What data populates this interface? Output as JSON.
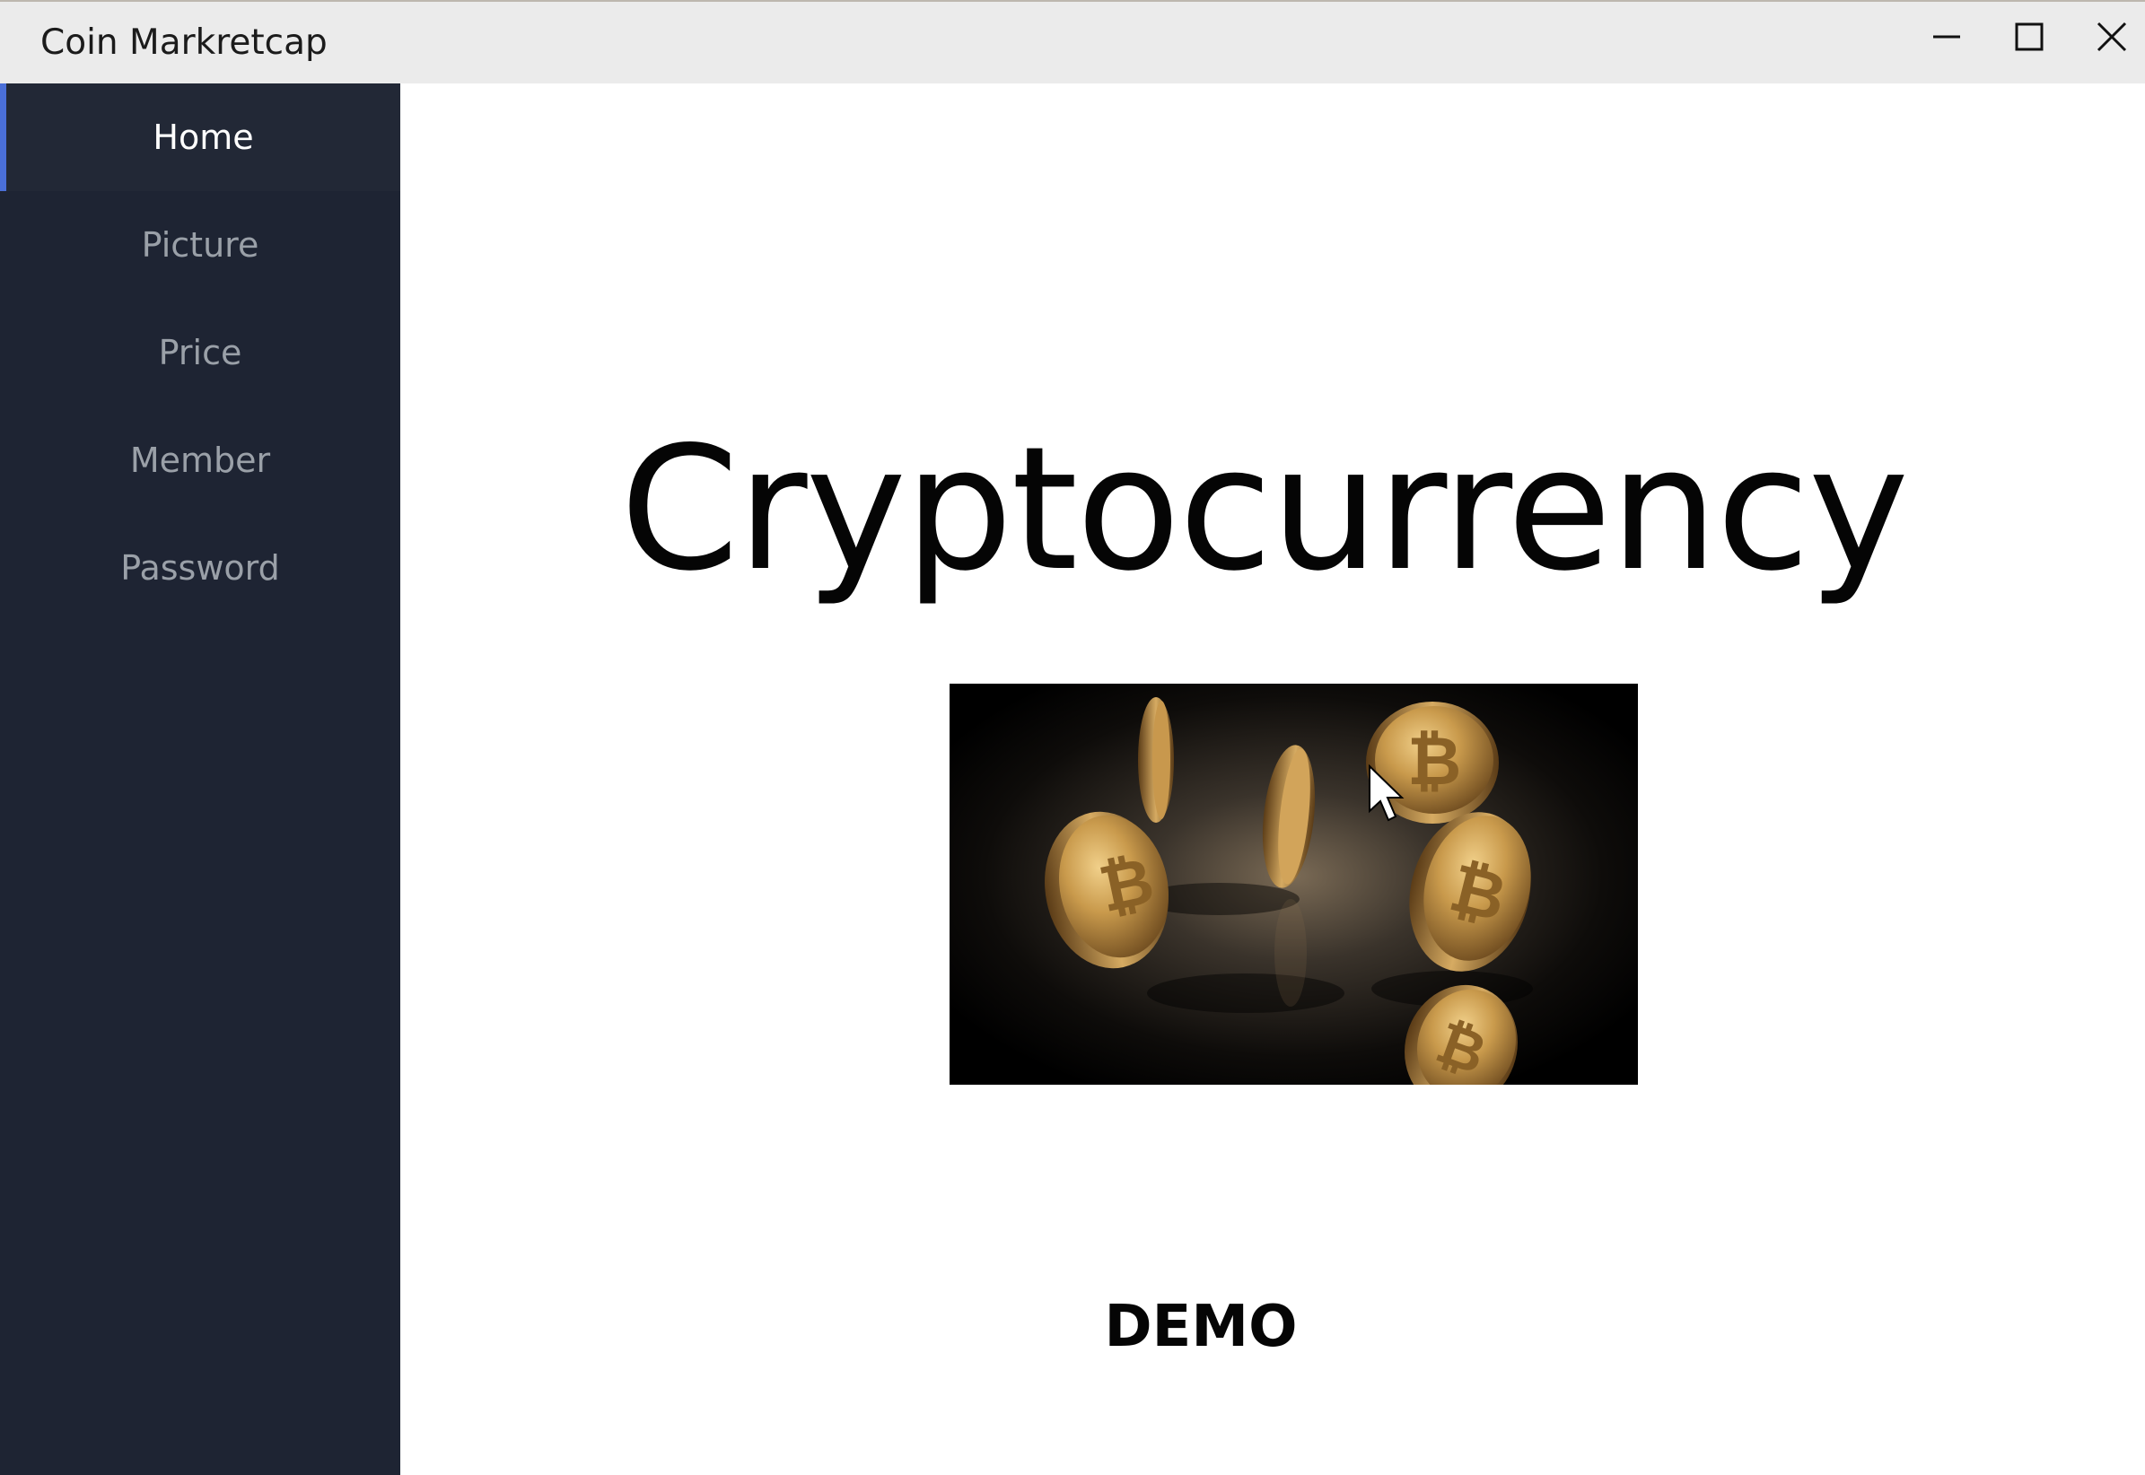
{
  "window": {
    "title": "Coin Markretcap"
  },
  "sidebar": {
    "items": [
      {
        "label": "Home",
        "active": true
      },
      {
        "label": "Picture",
        "active": false
      },
      {
        "label": "Price",
        "active": false
      },
      {
        "label": "Member",
        "active": false
      },
      {
        "label": "Password",
        "active": false
      }
    ]
  },
  "main": {
    "headline": "Cryptocurrency",
    "image_icon": "bitcoin-coins-image",
    "footer_label": "DEMO"
  },
  "colors": {
    "sidebar_bg": "#1e2433",
    "active_item_bg": "#222836",
    "active_accent": "#4a6fd8",
    "inactive_text": "#9aa0a8",
    "titlebar_bg": "#ebebeb"
  }
}
